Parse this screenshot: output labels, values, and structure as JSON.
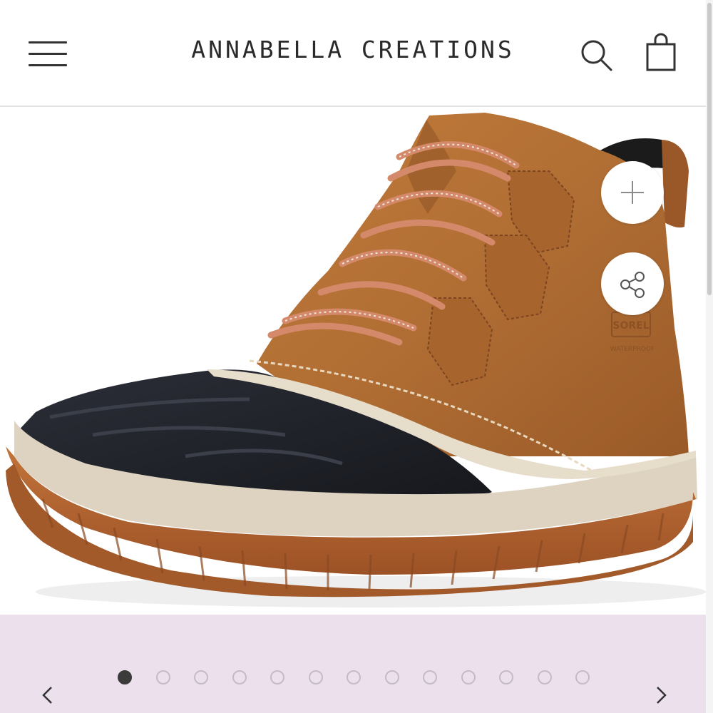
{
  "header": {
    "brand": "ANNABELLA CREATIONS",
    "menu_icon": "hamburger-menu-icon",
    "search_icon": "search-icon",
    "cart_icon": "shopping-bag-icon"
  },
  "product": {
    "image_subject": "boot-photo",
    "brand_stamp": "SOREL",
    "brand_stamp_sub": "WATERPROOF",
    "colors": {
      "leather": "#b06e34",
      "shell": "#1f2128",
      "sole": "#b2652f",
      "midsole": "#ddd3c0",
      "laces": "#d48a6a"
    }
  },
  "actions": {
    "zoom_icon": "plus-icon",
    "share_icon": "share-icon"
  },
  "carousel": {
    "dot_count": 13,
    "active_index": 0,
    "prev_icon": "chevron-left-icon",
    "next_icon": "chevron-right-icon",
    "band_color": "#ece0ec"
  }
}
